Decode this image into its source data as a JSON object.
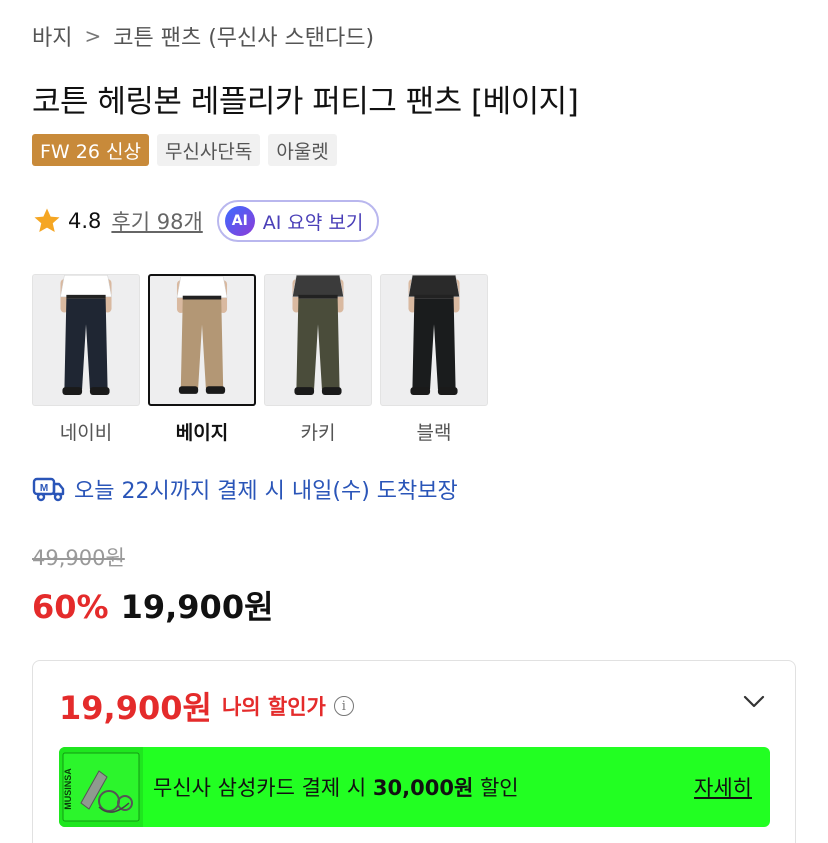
{
  "breadcrumb": {
    "category": "바지",
    "separator": ">",
    "current": "코튼 팬츠 (무신사 스탠다드)"
  },
  "product": {
    "title": "코튼 헤링본 레플리카 퍼티그 팬츠 [베이지]"
  },
  "badges": [
    "FW 26 신상",
    "무신사단독",
    "아울렛"
  ],
  "rating": {
    "score": "4.8",
    "reviews": "후기 98개",
    "ai_icon": "AI",
    "ai_label": "AI 요약 보기"
  },
  "colors": [
    {
      "name": "네이비",
      "selected": false,
      "pants": "#1f2633",
      "top": "#ffffff"
    },
    {
      "name": "베이지",
      "selected": true,
      "pants": "#b39775",
      "top": "#ffffff"
    },
    {
      "name": "카키",
      "selected": false,
      "pants": "#4a4c3a",
      "top": "#3b3b3b"
    },
    {
      "name": "블랙",
      "selected": false,
      "pants": "#1a1c1d",
      "top": "#2a2a2a"
    }
  ],
  "delivery": {
    "text": "오늘 22시까지 결제 시 내일(수) 도착보장",
    "icon": "truck-icon",
    "color": "#2a55b8"
  },
  "price": {
    "original": "49,900원",
    "discount": "60%",
    "sale": "19,900원"
  },
  "benefit": {
    "my_price": "19,900원",
    "my_price_label": "나의 할인가",
    "info_icon": "i",
    "card_brand": "MUSINSA",
    "card_text_prefix": "무신사 삼성카드 결제 시 ",
    "card_text_amount": "30,000원",
    "card_text_suffix": " 할인",
    "card_detail": "자세히",
    "banner_color": "#22ff22"
  },
  "colors_theme": {
    "accent_red": "#e42b2b",
    "badge_new": "#c88a3a"
  }
}
